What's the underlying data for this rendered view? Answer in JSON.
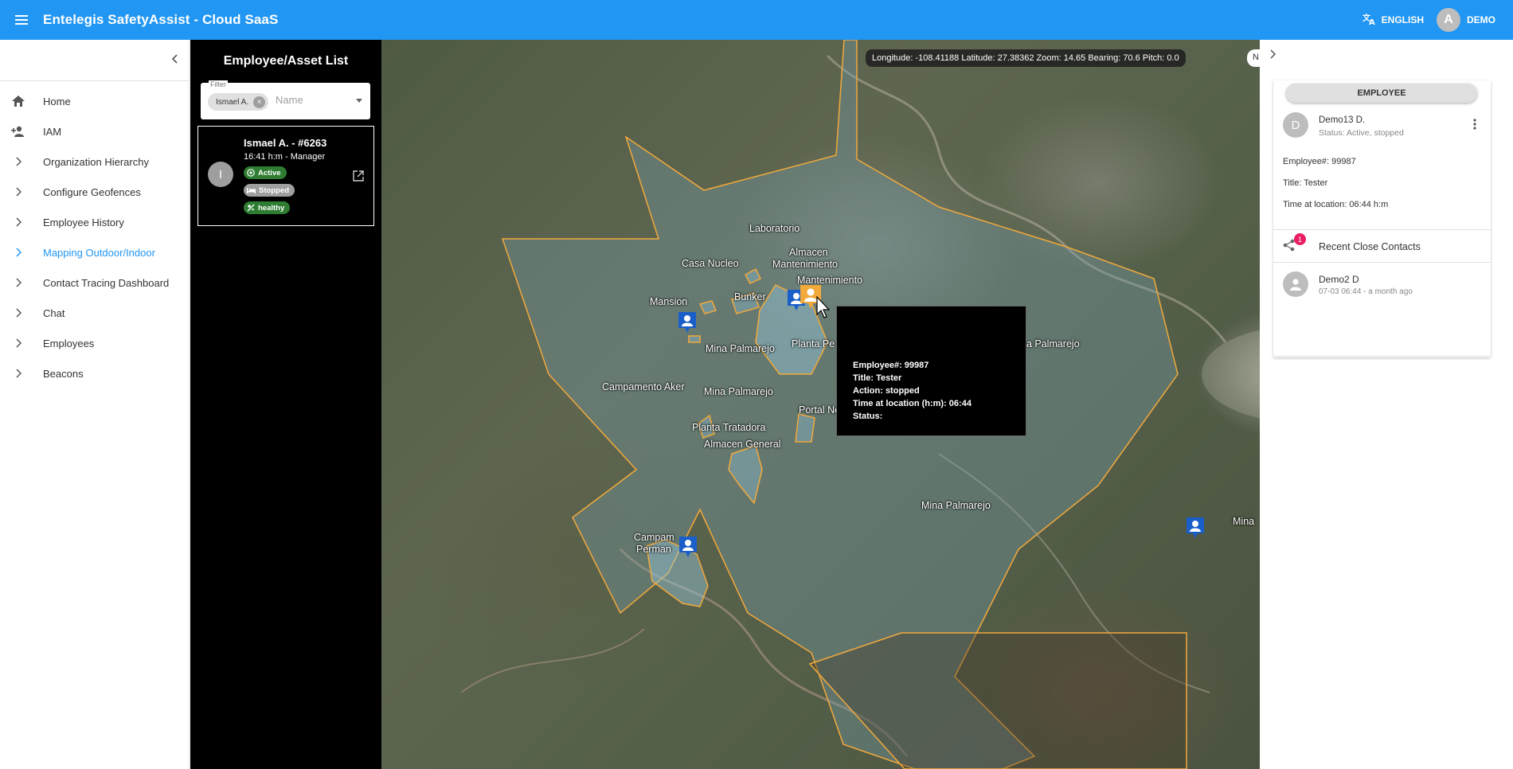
{
  "app": {
    "title": "Entelegis SafetyAssist - Cloud SaaS",
    "language": "ENGLISH",
    "user_initial": "A",
    "user_name": "DEMO"
  },
  "colors": {
    "primary": "#2196f3",
    "active": "#2e7d32",
    "geofence": "#f2a93b",
    "pin_blue": "#1a5ec9",
    "pin_orange": "#f2a93b",
    "notification": "#e91e63"
  },
  "sidebar": {
    "items": [
      {
        "label": "Home",
        "icon": "home-icon"
      },
      {
        "label": "IAM",
        "icon": "person-add-icon"
      },
      {
        "label": "Organization Hierarchy",
        "icon": "chevron-right-icon"
      },
      {
        "label": "Configure Geofences",
        "icon": "chevron-right-icon"
      },
      {
        "label": "Employee History",
        "icon": "chevron-right-icon"
      },
      {
        "label": "Mapping Outdoor/Indoor",
        "icon": "chevron-right-icon",
        "active": true
      },
      {
        "label": "Contact Tracing Dashboard",
        "icon": "chevron-right-icon"
      },
      {
        "label": "Chat",
        "icon": "chevron-right-icon"
      },
      {
        "label": "Employees",
        "icon": "chevron-right-icon"
      },
      {
        "label": "Beacons",
        "icon": "chevron-right-icon"
      }
    ]
  },
  "employee_list": {
    "title": "Employee/Asset List",
    "filter_legend": "Filter",
    "filter_chip": "Ismael A.",
    "filter_placeholder": "Name",
    "employee": {
      "initial": "I",
      "name": "Ismael A. - #6263",
      "subtitle": "16:41 h:m - Manager",
      "badges": [
        "Active",
        "Stopped",
        "healthy"
      ]
    }
  },
  "map": {
    "coordinates": "Longitude: -108.41188 Latitude: 27.38362 Zoom: 14.65 Bearing: 70.6 Pitch: 0.0",
    "control_partial": "N",
    "labels": [
      "Laboratorio",
      "Almacen",
      "Casa Nucleo",
      "Mantenimiento",
      "Mantenimiento",
      "Bunker",
      "Mansion",
      "Mina Palmarejo",
      "Planta Pe",
      "na Palmarejo",
      "Campamento Aker",
      "Mina Palmarejo",
      "Portal Norte",
      "Planta Tratadora",
      "Almacen General",
      "Mina Palmarejo",
      "Campam",
      "Perman",
      "Mina"
    ],
    "tooltip": {
      "employee": "Employee#: 99987",
      "title": "Title: Tester",
      "action": "Action: stopped",
      "time": "Time at location (h:m): 06:44",
      "status": "Status:"
    }
  },
  "detail": {
    "type_button": "EMPLOYEE",
    "initial": "D",
    "name": "Demo13 D.",
    "status": "Status: Active, stopped",
    "employee_no": "Employee#: 99987",
    "title": "Title: Tester",
    "time_at_location": "Time at location: 06:44 h:m",
    "recent_contacts_label": "Recent Close Contacts",
    "recent_contacts_count": "1",
    "contact": {
      "name": "Demo2 D",
      "time": "07-03 06:44 - a month ago"
    }
  }
}
